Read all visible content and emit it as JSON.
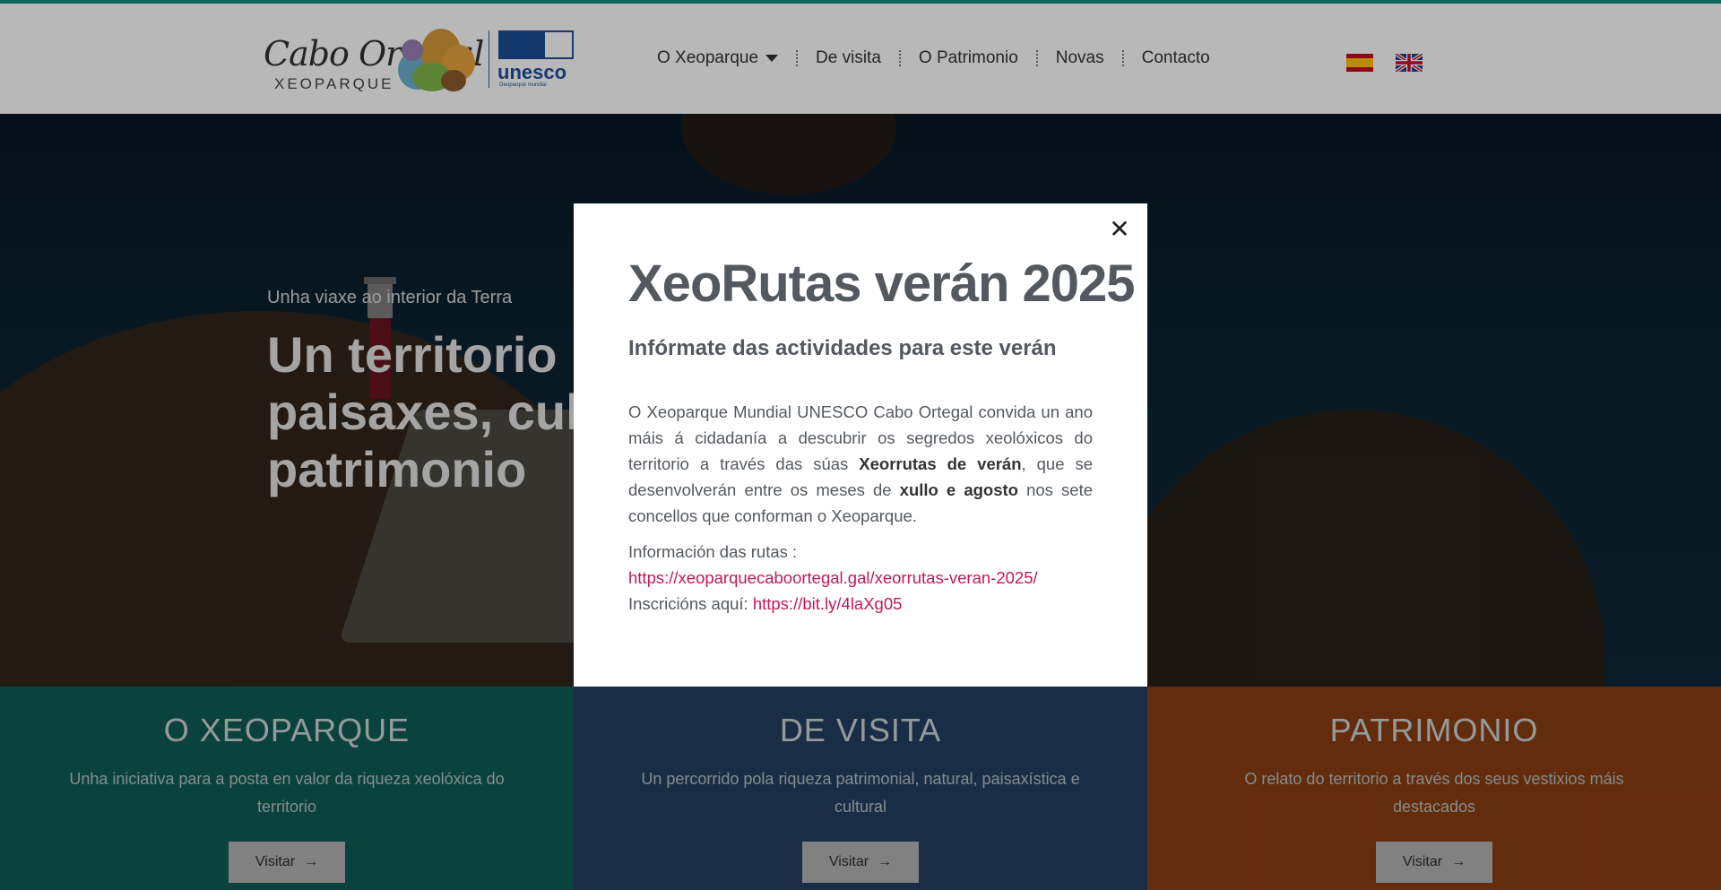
{
  "header": {
    "logo": {
      "brand": "Cabo Ortegal",
      "subtitle": "XEOPARQUE",
      "partner_word": "unesco",
      "partner_sub": "Geoparque mundial"
    },
    "nav": [
      {
        "label": "O Xeoparque",
        "has_dropdown": true
      },
      {
        "label": "De visita"
      },
      {
        "label": "O Patrimonio"
      },
      {
        "label": "Novas"
      },
      {
        "label": "Contacto"
      }
    ],
    "languages": [
      {
        "code": "es",
        "icon": "spain-flag-icon"
      },
      {
        "code": "en",
        "icon": "uk-flag-icon"
      }
    ]
  },
  "hero": {
    "kicker": "Unha viaxe ao interior da Terra",
    "title_line1": "Un territorio",
    "title_line2": "paisaxes, cult",
    "title_line3": "patrimonio"
  },
  "sections": [
    {
      "title": "O XEOPARQUE",
      "desc": "Unha iniciativa para a posta en valor da riqueza xeolóxica do territorio",
      "button": "Visitar",
      "color": "#0f5e55"
    },
    {
      "title": "DE VISITA",
      "desc": "Un percorrido pola riqueza patrimonial, natural, paisaxística e cultural",
      "button": "Visitar",
      "color": "#243f62"
    },
    {
      "title": "PATRIMONIO",
      "desc": "O relato do territorio a través dos seus vestixios máis destacados",
      "button": "Visitar",
      "color": "#8a3e12"
    }
  ],
  "modal": {
    "close_icon": "close-icon",
    "title": "XeoRutas verán 2025",
    "subtitle": "Infórmate das actividades para este verán",
    "p1_a": "O Xeoparque Mundial UNESCO Cabo Ortegal convida un ano máis á cidadanía a descubrir os segredos xeolóxicos do territorio a través das súas ",
    "p1_b": "Xeorrutas de verán",
    "p1_c": ", que se desenvolverán entre os meses de ",
    "p1_d": "xullo e agosto",
    "p1_e": " nos sete concellos que conforman o Xeoparque.",
    "info_label": "Información das rutas :",
    "info_link": "https://xeoparquecaboortegal.gal/xeorrutas-veran-2025/",
    "signup_label": "Inscricións aquí: ",
    "signup_link": "https://bit.ly/4laXg05"
  },
  "colors": {
    "accent_link": "#c2185b",
    "header_border": "#168f82",
    "text_gray": "#54595f"
  }
}
